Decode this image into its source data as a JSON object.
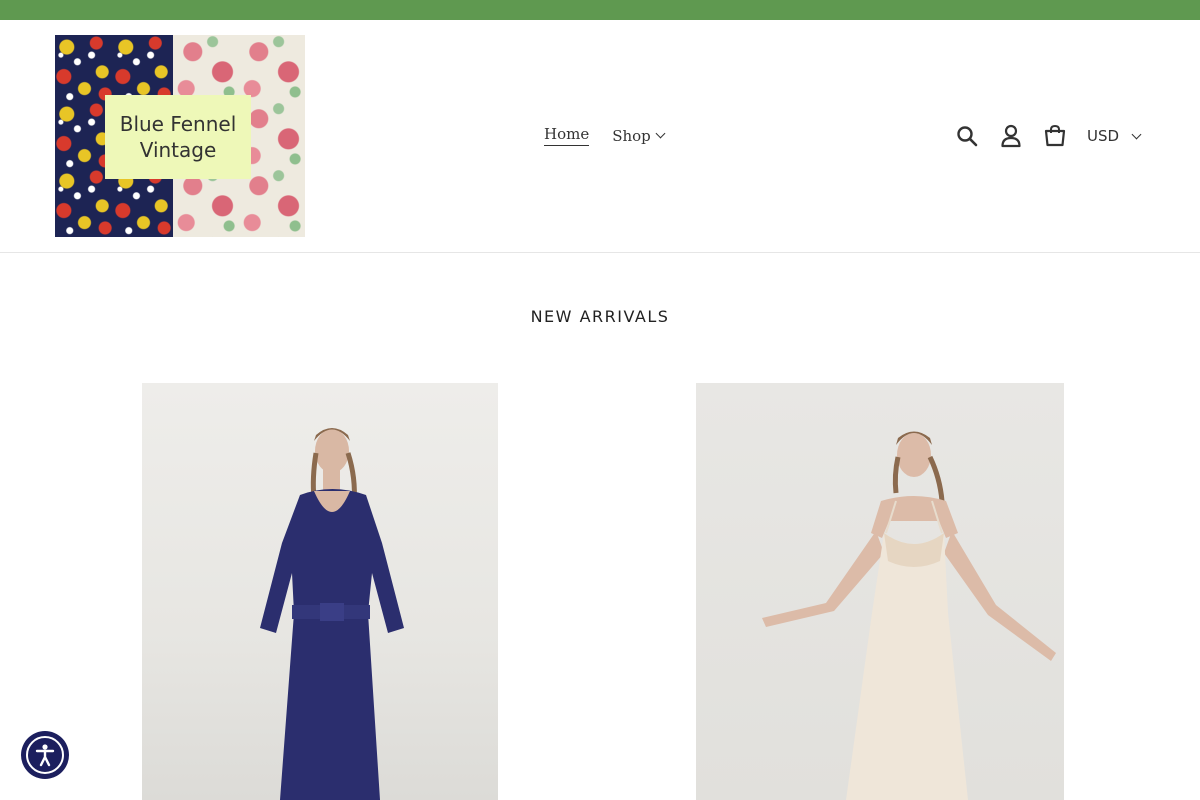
{
  "brand": {
    "line1": "Blue Fennel",
    "line2": "Vintage"
  },
  "nav": {
    "home_label": "Home",
    "shop_label": "Shop"
  },
  "header_icons": {
    "search": "search-icon",
    "account": "user-icon",
    "cart": "cart-icon"
  },
  "currency": {
    "selected": "USD"
  },
  "section": {
    "title": "NEW ARRIVALS"
  },
  "products": [
    {
      "description_icon": "product-photo-navy-knit-dress"
    },
    {
      "description_icon": "product-photo-ivory-slip-dress"
    }
  ],
  "colors": {
    "announcement_bar": "#5f9950",
    "accessibility_button": "#1c1f5e"
  }
}
